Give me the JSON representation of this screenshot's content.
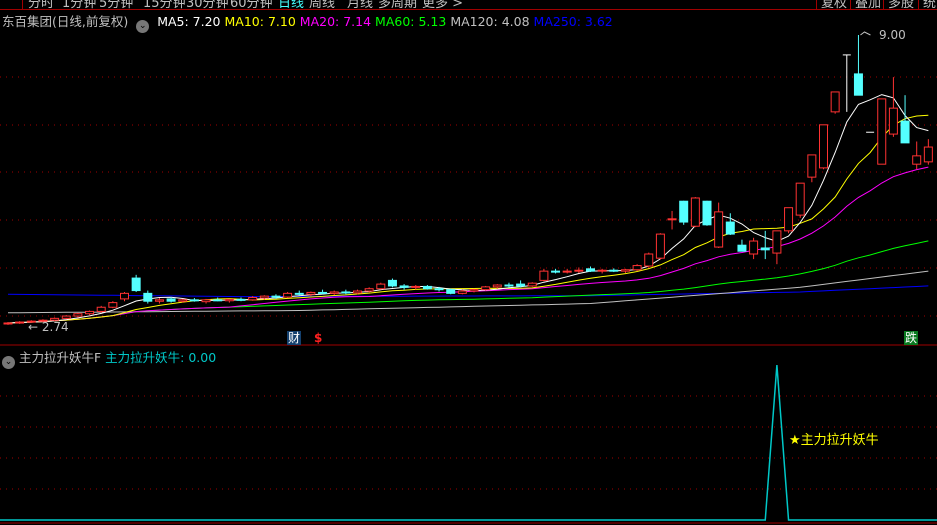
{
  "tabs": [
    "分时",
    "1分钟",
    "5分钟",
    "15分钟",
    "30分钟",
    "60分钟",
    "日线",
    "周线",
    "月线",
    "多周期",
    "更多 >"
  ],
  "active_tab": "日线",
  "right_buttons": [
    "复权",
    "叠加",
    "多股",
    "统"
  ],
  "stock": {
    "title": "东百集团(日线,前复权)"
  },
  "ma_legend": [
    {
      "label": "MA5: 7.20",
      "color": "#ffffff"
    },
    {
      "label": "MA10: 7.10",
      "color": "#ffff00"
    },
    {
      "label": "MA20: 7.14",
      "color": "#ff00ff"
    },
    {
      "label": "MA60: 5.13",
      "color": "#00ff00"
    },
    {
      "label": "MA120: 4.08",
      "color": "#c0c0c0"
    },
    {
      "label": "MA250: 3.62",
      "color": "#0000ff"
    }
  ],
  "annotations": {
    "high": "9.00",
    "low": "← 2.74",
    "marker_cai": "财",
    "marker_dollar": "$",
    "marker_die": "跌"
  },
  "indicator": {
    "name": "主力拉升妖牛F",
    "value_label": "主力拉升妖牛: 0.00",
    "signal_label": "★主力拉升妖牛"
  },
  "colors": {
    "up": "#ff3232",
    "down": "#54ffff",
    "grid": "#a00000",
    "indicator_line": "#00c8c8"
  },
  "chart_data": {
    "type": "candlestick",
    "price_range": [
      2.74,
      9.0
    ],
    "candles": [
      [
        2.76,
        2.8,
        2.74,
        2.78
      ],
      [
        2.78,
        2.82,
        2.76,
        2.8
      ],
      [
        2.8,
        2.84,
        2.78,
        2.82
      ],
      [
        2.82,
        2.86,
        2.8,
        2.84
      ],
      [
        2.84,
        2.9,
        2.82,
        2.88
      ],
      [
        2.88,
        2.95,
        2.86,
        2.93
      ],
      [
        2.93,
        3.0,
        2.9,
        2.98
      ],
      [
        2.98,
        3.05,
        2.95,
        3.03
      ],
      [
        3.03,
        3.15,
        3.0,
        3.12
      ],
      [
        3.12,
        3.25,
        3.1,
        3.22
      ],
      [
        3.3,
        3.45,
        3.25,
        3.42
      ],
      [
        3.75,
        3.82,
        3.45,
        3.48
      ],
      [
        3.42,
        3.48,
        3.2,
        3.25
      ],
      [
        3.25,
        3.32,
        3.2,
        3.28
      ],
      [
        3.3,
        3.34,
        3.22,
        3.25
      ],
      [
        3.25,
        3.3,
        3.22,
        3.28
      ],
      [
        3.28,
        3.32,
        3.24,
        3.26
      ],
      [
        3.24,
        3.3,
        3.2,
        3.28
      ],
      [
        3.28,
        3.33,
        3.25,
        3.27
      ],
      [
        3.26,
        3.3,
        3.22,
        3.29
      ],
      [
        3.29,
        3.33,
        3.25,
        3.28
      ],
      [
        3.28,
        3.36,
        3.26,
        3.33
      ],
      [
        3.32,
        3.38,
        3.28,
        3.36
      ],
      [
        3.36,
        3.4,
        3.3,
        3.34
      ],
      [
        3.34,
        3.45,
        3.32,
        3.42
      ],
      [
        3.42,
        3.48,
        3.38,
        3.4
      ],
      [
        3.4,
        3.46,
        3.36,
        3.44
      ],
      [
        3.44,
        3.5,
        3.4,
        3.42
      ],
      [
        3.42,
        3.48,
        3.38,
        3.45
      ],
      [
        3.45,
        3.5,
        3.4,
        3.43
      ],
      [
        3.43,
        3.5,
        3.4,
        3.47
      ],
      [
        3.47,
        3.55,
        3.44,
        3.52
      ],
      [
        3.52,
        3.65,
        3.5,
        3.62
      ],
      [
        3.7,
        3.74,
        3.55,
        3.58
      ],
      [
        3.58,
        3.62,
        3.5,
        3.55
      ],
      [
        3.55,
        3.6,
        3.5,
        3.57
      ],
      [
        3.57,
        3.6,
        3.5,
        3.52
      ],
      [
        3.52,
        3.56,
        3.46,
        3.5
      ],
      [
        3.5,
        3.52,
        3.4,
        3.42
      ],
      [
        3.42,
        3.5,
        3.4,
        3.47
      ],
      [
        3.47,
        3.52,
        3.44,
        3.5
      ],
      [
        3.5,
        3.58,
        3.48,
        3.56
      ],
      [
        3.56,
        3.62,
        3.52,
        3.6
      ],
      [
        3.6,
        3.65,
        3.55,
        3.58
      ],
      [
        3.62,
        3.7,
        3.55,
        3.58
      ],
      [
        3.58,
        3.66,
        3.56,
        3.64
      ],
      [
        3.7,
        3.95,
        3.68,
        3.9
      ],
      [
        3.9,
        3.95,
        3.85,
        3.88
      ],
      [
        3.88,
        3.95,
        3.85,
        3.9
      ],
      [
        3.9,
        3.98,
        3.86,
        3.92
      ],
      [
        3.95,
        4.0,
        3.88,
        3.9
      ],
      [
        3.9,
        3.95,
        3.85,
        3.92
      ],
      [
        3.92,
        3.96,
        3.88,
        3.9
      ],
      [
        3.9,
        3.95,
        3.86,
        3.93
      ],
      [
        3.93,
        4.05,
        3.9,
        4.02
      ],
      [
        4.01,
        4.3,
        3.98,
        4.27
      ],
      [
        4.18,
        4.72,
        4.15,
        4.7
      ],
      [
        5.02,
        5.2,
        4.8,
        5.03
      ],
      [
        5.41,
        5.42,
        4.9,
        4.96
      ],
      [
        4.87,
        5.5,
        4.85,
        5.48
      ],
      [
        5.41,
        5.42,
        4.88,
        4.9
      ],
      [
        4.42,
        5.38,
        4.4,
        5.18
      ],
      [
        4.96,
        5.15,
        4.68,
        4.7
      ],
      [
        4.46,
        4.58,
        4.33,
        4.33
      ],
      [
        4.27,
        4.62,
        4.16,
        4.55
      ],
      [
        4.4,
        4.77,
        4.16,
        4.36
      ],
      [
        4.29,
        4.77,
        4.05,
        4.77
      ],
      [
        4.77,
        5.27,
        4.72,
        5.27
      ],
      [
        5.11,
        5.8,
        5.05,
        5.8
      ],
      [
        5.93,
        6.41,
        5.82,
        6.41
      ],
      [
        6.13,
        7.06,
        6.1,
        7.06
      ],
      [
        7.34,
        7.77,
        7.3,
        7.77
      ],
      [
        8.57,
        8.57,
        7.34,
        8.57
      ],
      [
        8.16,
        9.0,
        7.7,
        7.7
      ],
      [
        6.9,
        6.9,
        6.9,
        6.9
      ],
      [
        6.21,
        7.62,
        6.21,
        7.62
      ],
      [
        6.86,
        8.09,
        6.8,
        7.42
      ],
      [
        7.14,
        7.7,
        6.67,
        6.67
      ],
      [
        6.21,
        6.7,
        6.1,
        6.39
      ],
      [
        6.26,
        6.75,
        6.2,
        6.58
      ]
    ],
    "ma120_anchors": [
      [
        0,
        3.0
      ],
      [
        25,
        3.05
      ],
      [
        50,
        3.2
      ],
      [
        68,
        3.55
      ],
      [
        79,
        3.9
      ]
    ],
    "ma250_anchors": [
      [
        0,
        3.4
      ],
      [
        20,
        3.35
      ],
      [
        50,
        3.37
      ],
      [
        68,
        3.45
      ],
      [
        79,
        3.58
      ]
    ],
    "indicator_series": {
      "name": "主力拉升妖牛",
      "range": [
        0,
        100
      ],
      "spike_index": 66,
      "spike_value": 100,
      "latest": 0.0
    }
  }
}
